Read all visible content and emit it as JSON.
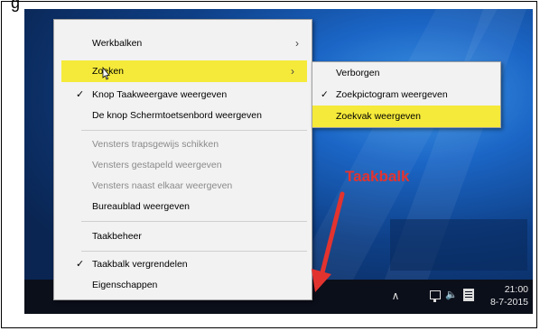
{
  "annotation": {
    "top_partial_text": "g",
    "label": "Taakbalk",
    "color": "#e3332f"
  },
  "context_menu": {
    "items": [
      {
        "label": "Werkbalken",
        "has_submenu": true
      },
      {
        "label": "Zoeken",
        "has_submenu": true,
        "highlighted": true
      },
      {
        "label": "Knop Taakweergave weergeven",
        "checked": true
      },
      {
        "label": "De knop Schermtoetsenbord weergeven"
      },
      {
        "label": "Vensters trapsgewijs schikken",
        "disabled": true
      },
      {
        "label": "Vensters gestapeld weergeven",
        "disabled": true
      },
      {
        "label": "Vensters naast elkaar weergeven",
        "disabled": true
      },
      {
        "label": "Bureaublad weergeven"
      },
      {
        "label": "Taakbeheer"
      },
      {
        "label": "Taakbalk vergrendelen",
        "checked": true
      },
      {
        "label": "Eigenschappen"
      }
    ],
    "highlight_color": "#f5ea3a"
  },
  "submenu": {
    "items": [
      {
        "label": "Verborgen"
      },
      {
        "label": "Zoekpictogram weergeven",
        "checked": true
      },
      {
        "label": "Zoekvak weergeven",
        "highlighted": true
      }
    ]
  },
  "glyphs": {
    "check": "✓",
    "submenu_arrow": "›",
    "tray_chevron": "∧",
    "volume": "🔈"
  },
  "taskbar": {
    "time": "21:00",
    "date": "8-7-2015",
    "tray_icons": [
      "chevron-up-icon",
      "network-icon",
      "volume-icon",
      "action-center-icon"
    ]
  }
}
